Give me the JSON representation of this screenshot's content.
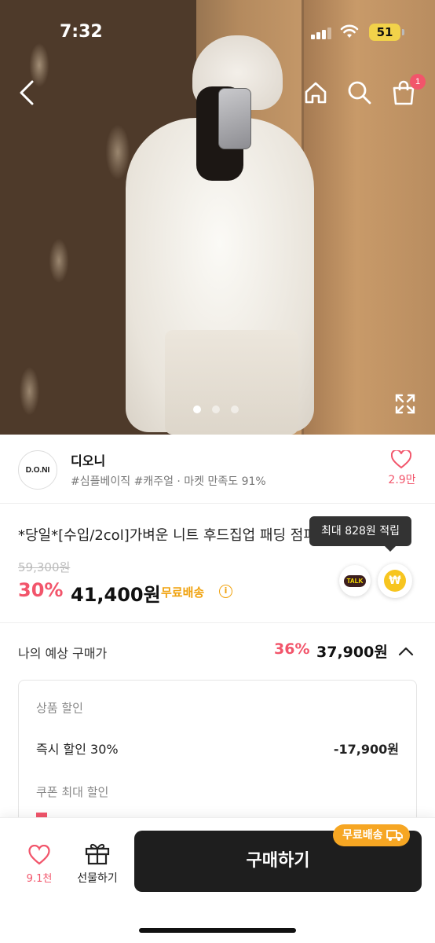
{
  "status_bar": {
    "time": "7:32",
    "battery": "51"
  },
  "nav": {
    "cart_count": "1"
  },
  "carousel": {
    "total": 3,
    "active": 1
  },
  "seller": {
    "logo_text": "D.O.NI",
    "name": "디오니",
    "tags": "#심플베이직 #캐주얼 · 마켓 만족도 91%",
    "likes": "2.9만"
  },
  "product": {
    "title": "*당일*[수입/2col]가벼운 니트 후드집업 패딩 점퍼",
    "tooltip": "최대 828원 적립",
    "original_price": "59,300원",
    "discount": "30%",
    "price": "41,400원",
    "shipping": "무료배송",
    "talk_label": "TALK",
    "point_symbol": "₩"
  },
  "expected": {
    "label": "나의 예상 구매가",
    "discount": "36%",
    "price": "37,900원"
  },
  "breakdown": {
    "product_discount_label": "상품 할인",
    "instant_label": "즉시 할인 30%",
    "instant_value": "-17,900원",
    "coupon_label": "쿠폰 최대 할인"
  },
  "bottom": {
    "like_count": "9.1천",
    "gift_label": "선물하기",
    "buy_label": "구매하기",
    "ship_badge": "무료배송"
  },
  "colors": {
    "accent": "#f2556b",
    "shipping": "#f0a20e",
    "buy_button": "#1e1e1e"
  }
}
